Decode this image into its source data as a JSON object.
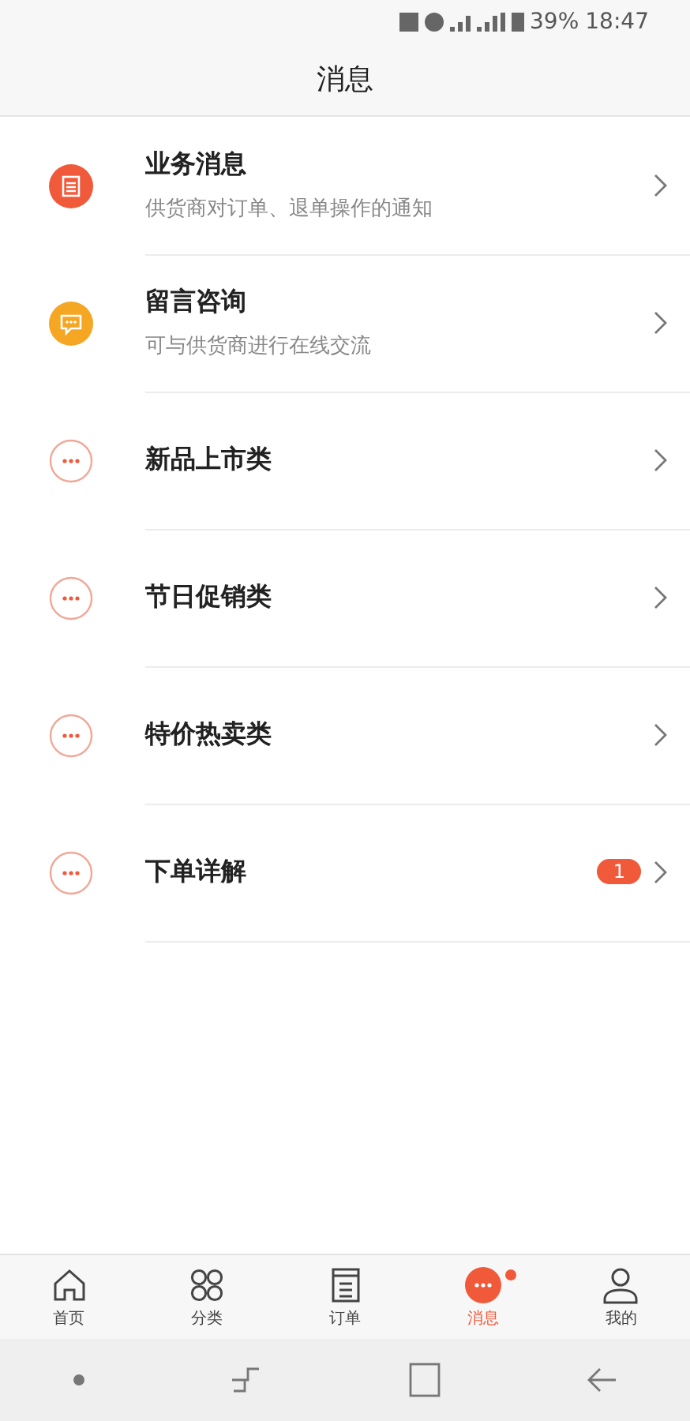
{
  "status_bar": {
    "battery": "39%",
    "time": "18:47"
  },
  "header": {
    "title": "消息"
  },
  "messages": [
    {
      "kind": "doc",
      "title": "业务消息",
      "subtitle": "供货商对订单、退单操作的通知"
    },
    {
      "kind": "chat",
      "title": "留言咨询",
      "subtitle": "可与供货商进行在线交流"
    },
    {
      "kind": "more",
      "title": "新品上市类"
    },
    {
      "kind": "more",
      "title": "节日促销类"
    },
    {
      "kind": "more",
      "title": "特价热卖类"
    },
    {
      "kind": "more",
      "title": "下单详解",
      "badge": "1"
    }
  ],
  "tab_bar": [
    {
      "kind": "home",
      "label": "首页",
      "selected": false,
      "dot": false
    },
    {
      "kind": "category",
      "label": "分类",
      "selected": false,
      "dot": false
    },
    {
      "kind": "order",
      "label": "订单",
      "selected": false,
      "dot": false
    },
    {
      "kind": "message",
      "label": "消息",
      "selected": true,
      "dot": true
    },
    {
      "kind": "me",
      "label": "我的",
      "selected": false,
      "dot": false
    }
  ]
}
